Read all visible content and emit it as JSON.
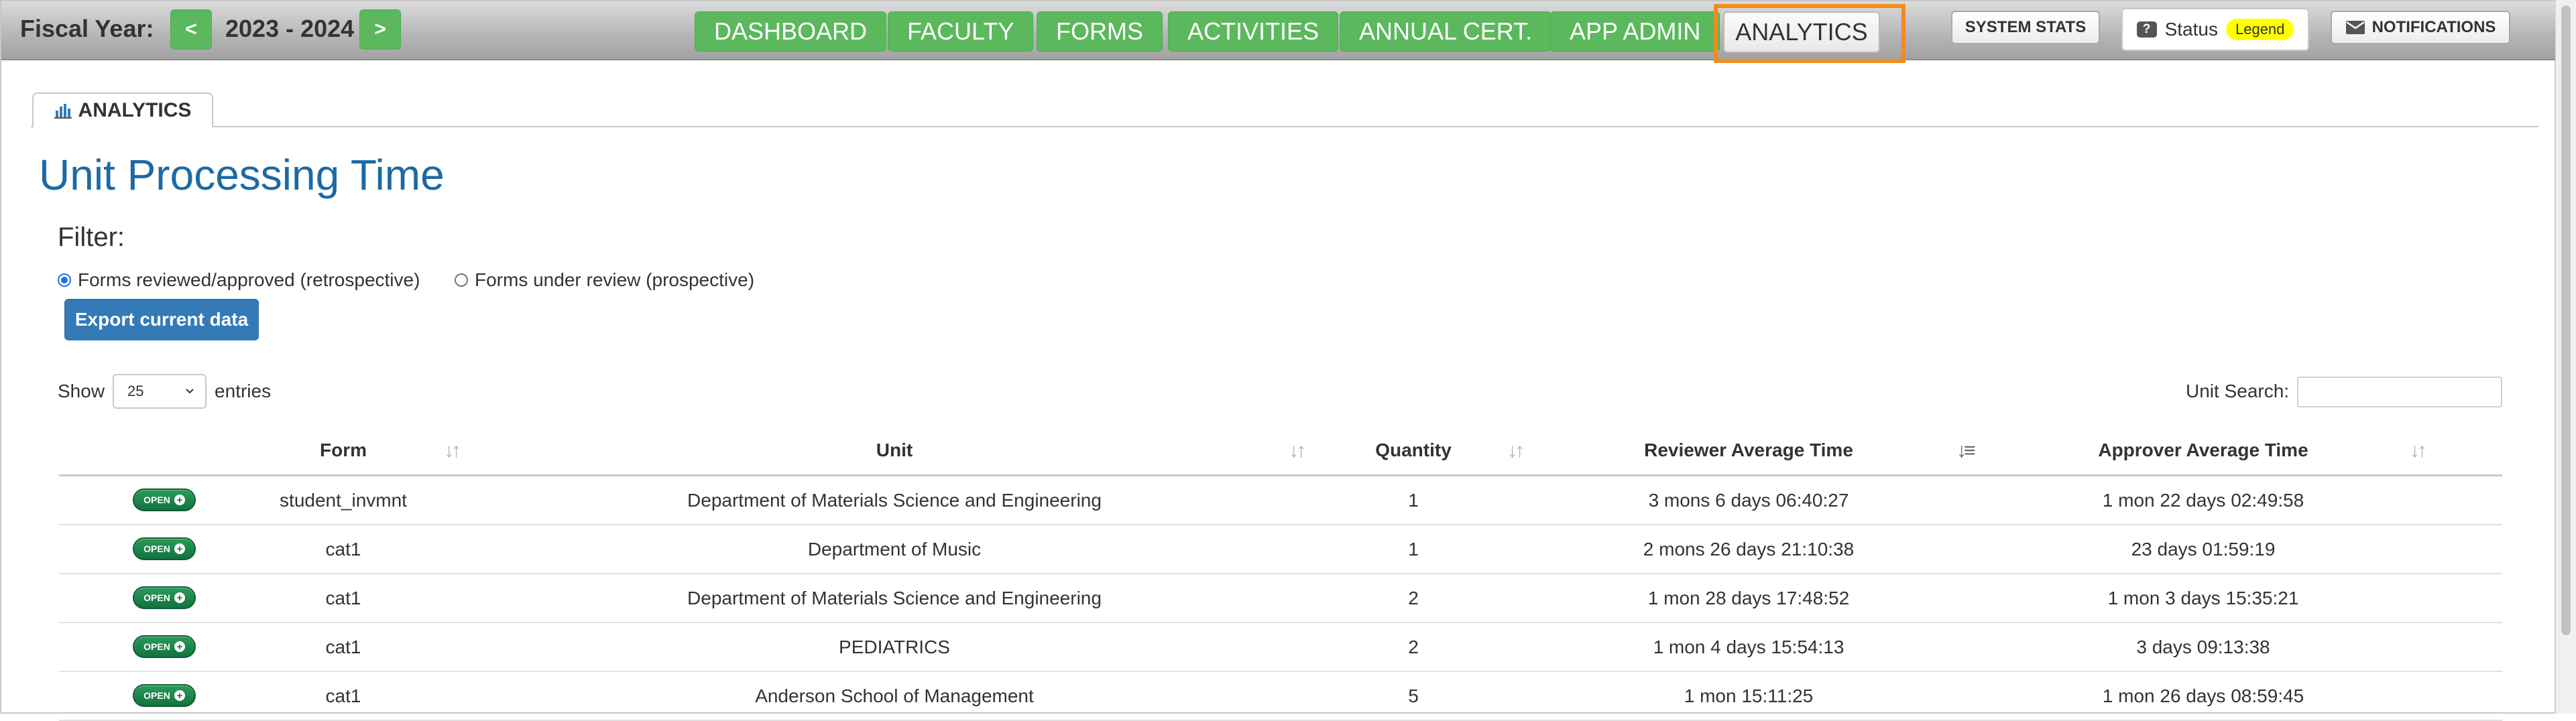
{
  "topbar": {
    "fiscal_year_label": "Fiscal Year:",
    "prev_label": "<",
    "next_label": ">",
    "fiscal_year_value": "2023 - 2024",
    "nav": [
      {
        "label": "DASHBOARD"
      },
      {
        "label": "FACULTY"
      },
      {
        "label": "FORMS"
      },
      {
        "label": "ACTIVITIES"
      },
      {
        "label": "ANNUAL CERT."
      },
      {
        "label": "APP ADMIN"
      },
      {
        "label": "ANALYTICS"
      }
    ],
    "system_stats_label": "SYSTEM STATS",
    "status_label": "Status",
    "legend_label": "Legend",
    "notifications_label": "NOTIFICATIONS"
  },
  "tab": {
    "label": "ANALYTICS"
  },
  "page": {
    "title": "Unit Processing Time",
    "filter_label": "Filter:",
    "radio_retrospective": "Forms reviewed/approved (retrospective)",
    "radio_prospective": "Forms under review (prospective)",
    "export_label": "Export current data"
  },
  "table_controls": {
    "show_label": "Show",
    "page_size": "25",
    "entries_label": "entries",
    "unit_search_label": "Unit Search:"
  },
  "table": {
    "headers": [
      "Form",
      "Unit",
      "Quantity",
      "Reviewer Average Time",
      "Approver Average Time"
    ],
    "open_label": "OPEN",
    "rows": [
      {
        "form": "student_invmnt",
        "unit": "Department of Materials Science and Engineering",
        "quantity": "1",
        "reviewer": "3 mons 6 days 06:40:27",
        "approver": "1 mon 22 days 02:49:58"
      },
      {
        "form": "cat1",
        "unit": "Department of Music",
        "quantity": "1",
        "reviewer": "2 mons 26 days 21:10:38",
        "approver": "23 days 01:59:19"
      },
      {
        "form": "cat1",
        "unit": "Department of Materials Science and Engineering",
        "quantity": "2",
        "reviewer": "1 mon 28 days 17:48:52",
        "approver": "1 mon 3 days 15:35:21"
      },
      {
        "form": "cat1",
        "unit": "PEDIATRICS",
        "quantity": "2",
        "reviewer": "1 mon 4 days 15:54:13",
        "approver": "3 days 09:13:38"
      },
      {
        "form": "cat1",
        "unit": "Anderson School of Management",
        "quantity": "5",
        "reviewer": "1 mon 15:11:25",
        "approver": "1 mon 26 days 08:59:45"
      }
    ]
  },
  "colors": {
    "nav_green": "#5cb85c",
    "title_blue": "#1b6aa4",
    "export_blue": "#337ab7",
    "highlight_orange": "#ef8d1c",
    "legend_yellow": "#ffff00"
  }
}
